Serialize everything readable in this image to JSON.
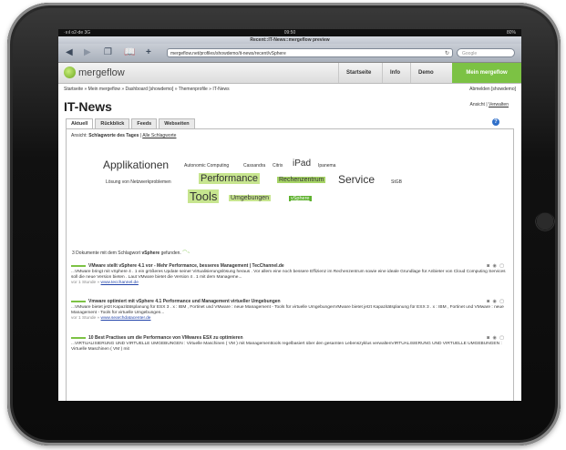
{
  "status_bar": {
    "carrier": "·ıııl o2-de 3G",
    "time": "09:50",
    "battery": "80%"
  },
  "browser": {
    "page_title": "Recent::IT-News::mergeflow preview",
    "url": "mergeflow.net/profiles/showdemo/it-news/recent/vSphere",
    "search_placeholder": "Google",
    "icons": [
      "back-icon",
      "forward-icon",
      "tabs-icon",
      "bookmarks-icon",
      "add-icon",
      "reload-icon"
    ]
  },
  "site": {
    "logo_text": "mergeflow",
    "nav": [
      "Startseite",
      "Info",
      "Demo",
      "Mein mergeflow"
    ],
    "accent_color": "#7cc244"
  },
  "breadcrumb": {
    "path": "Startseite » Mein mergeflow » Dashboard [showdemo] » Themenprofile » IT-News",
    "right": "Abmelden [showdemo]"
  },
  "page": {
    "title": "IT-News",
    "ansicht_label": "Ansicht |",
    "ansicht_link": "Verwalten",
    "tabs": [
      "Aktuell",
      "Rückblick",
      "Feeds",
      "Webseiten"
    ],
    "view_prefix": "Ansicht:",
    "view_current": "Schlagworte des Tages",
    "view_all": "Alle Schlagworte"
  },
  "tag_cloud": [
    "Applikationen",
    "Autonomic Computing",
    "Cassandra",
    "Citrix",
    "iPad",
    "Ipanema",
    "Lösung von Netzwerkproblemen",
    "Performance",
    "Rechenzentrum",
    "Service",
    "StGB",
    "Tools",
    "Umgebungen",
    "vSphere"
  ],
  "results_summary": {
    "count": "3",
    "text_before": "Dokumente mit dem Schlagwort",
    "keyword": "vSphere",
    "text_after": "gefunden."
  },
  "results": [
    {
      "title": "VMware stellt vSphere 4.1 vor - Mehr Performance, besseres Management | TecChannel.de",
      "snippet": "...VMware bringt mit vSphere 4 . 1 ein größeres Update seiner Virtualisierungslösung heraus . Vor allem eine noch bessere Effizienz im Rechenzentrum sowie eine ideale Grundlage für Anbieter von Cloud Computing Services soll die neue Version bieten . Laut VMware bietet die Version 4 . 1 mit dem Manageme...",
      "age": "vor 1 Stunde »",
      "source": "www.tecchannel.de"
    },
    {
      "title": "Vmware optimiert mit vSphere 4.1 Performance und Management virtueller Umgebungen",
      "snippet": "...VMware bietet jetzt Kapazitätsplanung für ESX 3 . x : IBM , Fortinet und VMware : neue Management - Tools für virtuelle UmgebungenVMware bietet jetzt Kapazitätsplanung für ESX 3 . x : IBM , Fortinet und VMware : neue Management - Tools für virtuelle Umgebungen...",
      "age": "vor 1 Stunde »",
      "source": "www.searchdatacenter.de"
    },
    {
      "title": "10 Best Practises um die Performance von VMwares ESX zu optimieren",
      "snippet": "...VIRTUALISIERUNG UND VIRTUELLE UMGEBUNGEN : Virtuelle Maschinen ( VM ) mit Managementtools regelbasiert über den gesamten Lebenszyklus verwaltenVIRTUALISIERUNG UND VIRTUELLE UMGEBUNGEN : Virtuelle Maschinen ( VM ) mit",
      "age": "",
      "source": ""
    }
  ]
}
